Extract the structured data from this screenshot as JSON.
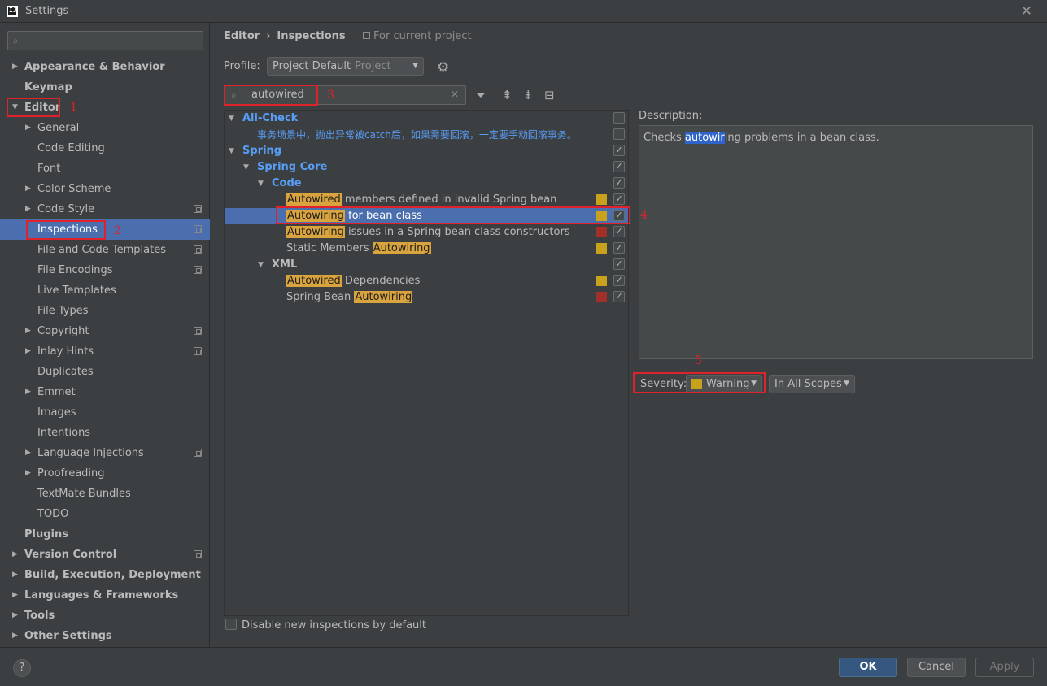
{
  "window": {
    "title": "Settings",
    "app_icon_letter": "IJ"
  },
  "sidebar": {
    "search_placeholder": "",
    "items": [
      {
        "label": "Appearance & Behavior",
        "bold": true,
        "arrow": "right",
        "level": 0
      },
      {
        "label": "Keymap",
        "bold": true,
        "arrow": "none",
        "level": 0
      },
      {
        "label": "Editor",
        "bold": true,
        "arrow": "down",
        "level": 0
      },
      {
        "label": "General",
        "bold": false,
        "arrow": "right",
        "level": 1
      },
      {
        "label": "Code Editing",
        "bold": false,
        "arrow": "none",
        "level": 1
      },
      {
        "label": "Font",
        "bold": false,
        "arrow": "none",
        "level": 1
      },
      {
        "label": "Color Scheme",
        "bold": false,
        "arrow": "right",
        "level": 1
      },
      {
        "label": "Code Style",
        "bold": false,
        "arrow": "right",
        "level": 1,
        "project": true
      },
      {
        "label": "Inspections",
        "bold": false,
        "arrow": "none",
        "level": 1,
        "project": true,
        "selected": true
      },
      {
        "label": "File and Code Templates",
        "bold": false,
        "arrow": "none",
        "level": 1,
        "project": true
      },
      {
        "label": "File Encodings",
        "bold": false,
        "arrow": "none",
        "level": 1,
        "project": true
      },
      {
        "label": "Live Templates",
        "bold": false,
        "arrow": "none",
        "level": 1
      },
      {
        "label": "File Types",
        "bold": false,
        "arrow": "none",
        "level": 1
      },
      {
        "label": "Copyright",
        "bold": false,
        "arrow": "right",
        "level": 1,
        "project": true
      },
      {
        "label": "Inlay Hints",
        "bold": false,
        "arrow": "right",
        "level": 1,
        "project": true
      },
      {
        "label": "Duplicates",
        "bold": false,
        "arrow": "none",
        "level": 1
      },
      {
        "label": "Emmet",
        "bold": false,
        "arrow": "right",
        "level": 1
      },
      {
        "label": "Images",
        "bold": false,
        "arrow": "none",
        "level": 1
      },
      {
        "label": "Intentions",
        "bold": false,
        "arrow": "none",
        "level": 1
      },
      {
        "label": "Language Injections",
        "bold": false,
        "arrow": "right",
        "level": 1,
        "project": true
      },
      {
        "label": "Proofreading",
        "bold": false,
        "arrow": "right",
        "level": 1
      },
      {
        "label": "TextMate Bundles",
        "bold": false,
        "arrow": "none",
        "level": 1
      },
      {
        "label": "TODO",
        "bold": false,
        "arrow": "none",
        "level": 1
      },
      {
        "label": "Plugins",
        "bold": true,
        "arrow": "none",
        "level": 0
      },
      {
        "label": "Version Control",
        "bold": true,
        "arrow": "right",
        "level": 0,
        "project": true
      },
      {
        "label": "Build, Execution, Deployment",
        "bold": true,
        "arrow": "right",
        "level": 0
      },
      {
        "label": "Languages & Frameworks",
        "bold": true,
        "arrow": "right",
        "level": 0
      },
      {
        "label": "Tools",
        "bold": true,
        "arrow": "right",
        "level": 0
      },
      {
        "label": "Other Settings",
        "bold": true,
        "arrow": "right",
        "level": 0
      }
    ]
  },
  "annotations": [
    "1",
    "2",
    "3",
    "4",
    "5"
  ],
  "main": {
    "breadcrumb": [
      "Editor",
      "Inspections"
    ],
    "breadcrumb_sep": "›",
    "scope_note": "For current project",
    "profile_label": "Profile:",
    "profile_value": "Project Default",
    "profile_sub": "Project",
    "filter_value": "autowired",
    "inspections": [
      {
        "level": 0,
        "arrow": "down",
        "group": true,
        "parts": [
          {
            "t": "Ali-Check"
          }
        ],
        "checked": false
      },
      {
        "level": 1,
        "arrow": "none",
        "group": false,
        "note": true,
        "parts": [
          {
            "t": "事务场景中，抛出异常被catch后，如果需要回滚，一定要手动回滚事务。"
          }
        ],
        "checked": false
      },
      {
        "level": 0,
        "arrow": "down",
        "group": true,
        "parts": [
          {
            "t": "Spring"
          }
        ],
        "checked": true
      },
      {
        "level": 1,
        "arrow": "down",
        "group": true,
        "parts": [
          {
            "t": "Spring Core"
          }
        ],
        "checked": true
      },
      {
        "level": 2,
        "arrow": "down",
        "group": true,
        "parts": [
          {
            "t": "Code"
          }
        ],
        "checked": true
      },
      {
        "level": 3,
        "arrow": "none",
        "group": false,
        "parts": [
          {
            "t": "Autowired",
            "hl": true
          },
          {
            "t": " members defined in invalid Spring bean"
          }
        ],
        "severity": "#c8a11d",
        "checked": true
      },
      {
        "level": 3,
        "arrow": "none",
        "group": false,
        "selected": true,
        "parts": [
          {
            "t": "Autowiring",
            "hl": true
          },
          {
            "t": " for bean class"
          }
        ],
        "severity": "#c8a11d",
        "checked": true
      },
      {
        "level": 3,
        "arrow": "none",
        "group": false,
        "parts": [
          {
            "t": "Autowiring",
            "hl": true
          },
          {
            "t": " issues in a Spring bean class constructors"
          }
        ],
        "severity": "#a1302b",
        "checked": true
      },
      {
        "level": 3,
        "arrow": "none",
        "group": false,
        "parts": [
          {
            "t": "Static Members "
          },
          {
            "t": "Autowiring",
            "hl": true
          }
        ],
        "severity": "#c8a11d",
        "checked": true
      },
      {
        "level": 2,
        "arrow": "down",
        "group": false,
        "xml": true,
        "parts": [
          {
            "t": "XML"
          }
        ],
        "checked": true
      },
      {
        "level": 3,
        "arrow": "none",
        "group": false,
        "parts": [
          {
            "t": "Autowired",
            "hl": true
          },
          {
            "t": " Dependencies"
          }
        ],
        "severity": "#c8a11d",
        "checked": true
      },
      {
        "level": 3,
        "arrow": "none",
        "group": false,
        "parts": [
          {
            "t": "Spring Bean "
          },
          {
            "t": "Autowiring",
            "hl": true
          }
        ],
        "severity": "#a1302b",
        "checked": true
      }
    ],
    "disable_new_label": "Disable new inspections by default",
    "description_label": "Description:",
    "description": {
      "before": "Checks ",
      "highlight": "autowir",
      "after": "ing problems in a bean class."
    },
    "severity_label": "Severity:",
    "severity_value": "Warning",
    "scope_value": "In All Scopes"
  },
  "footer": {
    "help": "?",
    "ok": "OK",
    "cancel": "Cancel",
    "apply": "Apply"
  },
  "colors": {
    "selection": "#4b6eaf",
    "group_blue": "#589df6",
    "warning": "#c8a11d",
    "error": "#a1302b",
    "annotation_red": "#e0222b"
  }
}
